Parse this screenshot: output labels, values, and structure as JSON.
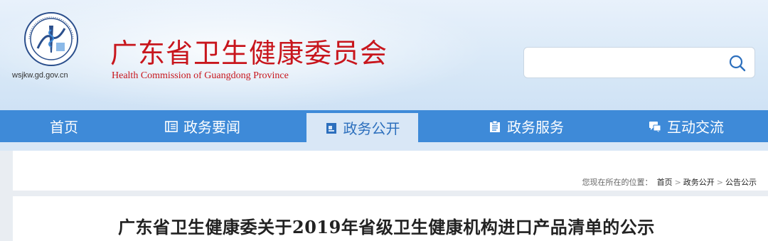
{
  "header": {
    "title": "广东省卫生健康委员会",
    "subtitle": "Health Commission of Guangdong Province",
    "domain": "wsjkw.gd.gov.cn",
    "logo_text": "广东省卫生健康委员会",
    "brand_color": "#c8161d"
  },
  "search": {
    "value": "",
    "icon": "search-icon"
  },
  "nav": {
    "items": [
      {
        "label": "首页",
        "icon": "",
        "active": false
      },
      {
        "label": "政务要闻",
        "icon": "news-list-icon",
        "active": false
      },
      {
        "label": "政务公开",
        "icon": "folder-icon",
        "active": true
      },
      {
        "label": "政务服务",
        "icon": "clipboard-icon",
        "active": false
      },
      {
        "label": "互动交流",
        "icon": "chat-icon",
        "active": false
      }
    ],
    "bg_color": "#3e8ad8",
    "active_bg_color": "#d9e7f6"
  },
  "breadcrumb": {
    "lead": "您现在所在的位置：",
    "items": [
      "首页",
      "政务公开",
      "公告公示"
    ],
    "separator": ">"
  },
  "article": {
    "title": "广东省卫生健康委关于2019年省级卫生健康机构进口产品清单的公示"
  }
}
